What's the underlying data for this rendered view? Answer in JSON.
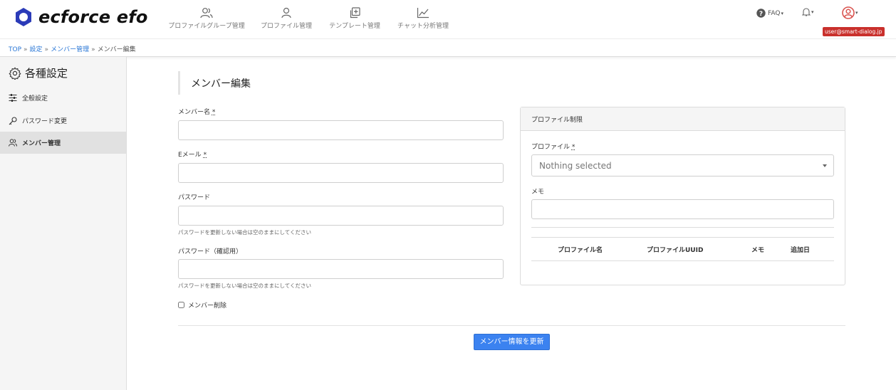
{
  "header": {
    "logo_text": "ecforce efo",
    "nav": [
      {
        "label": "プロファイルグループ管理",
        "icon": "users-icon"
      },
      {
        "label": "プロファイル管理",
        "icon": "user-icon"
      },
      {
        "label": "テンプレート管理",
        "icon": "copy-plus-icon"
      },
      {
        "label": "チャット分析管理",
        "icon": "line-chart-icon"
      }
    ],
    "faq_label": "FAQ",
    "user_email": "user@smart-dialog.jp",
    "colors": {
      "brand": "#2b3bb8",
      "badge": "#c9302c",
      "danger_icon": "#d9534f"
    }
  },
  "breadcrumb": {
    "items": [
      "TOP",
      "設定",
      "メンバー管理"
    ],
    "current": "メンバー編集",
    "separator": "»"
  },
  "sidebar": {
    "title": "各種設定",
    "items": [
      {
        "label": "全般設定",
        "icon": "sliders-icon",
        "active": false
      },
      {
        "label": "パスワード変更",
        "icon": "key-icon",
        "active": false
      },
      {
        "label": "メンバー管理",
        "icon": "users-icon",
        "active": true
      }
    ]
  },
  "form": {
    "title": "メンバー編集",
    "name_label": "メンバー名",
    "email_label": "Eメール",
    "password_label": "パスワード",
    "password_help": "パスワードを更新しない場合は空のままにしてください",
    "password_confirm_label": "パスワード（確認用）",
    "password_confirm_help": "パスワードを更新しない場合は空のままにしてください",
    "delete_label": "メンバー削除",
    "required_mark": "*",
    "submit_label": "メンバー情報を更新"
  },
  "profile_panel": {
    "title": "プロファイル制限",
    "profile_label": "プロファイル",
    "profile_placeholder": "Nothing selected",
    "memo_label": "メモ",
    "columns": [
      "プロファイル名",
      "プロファイルUUID",
      "メモ",
      "追加日"
    ]
  }
}
